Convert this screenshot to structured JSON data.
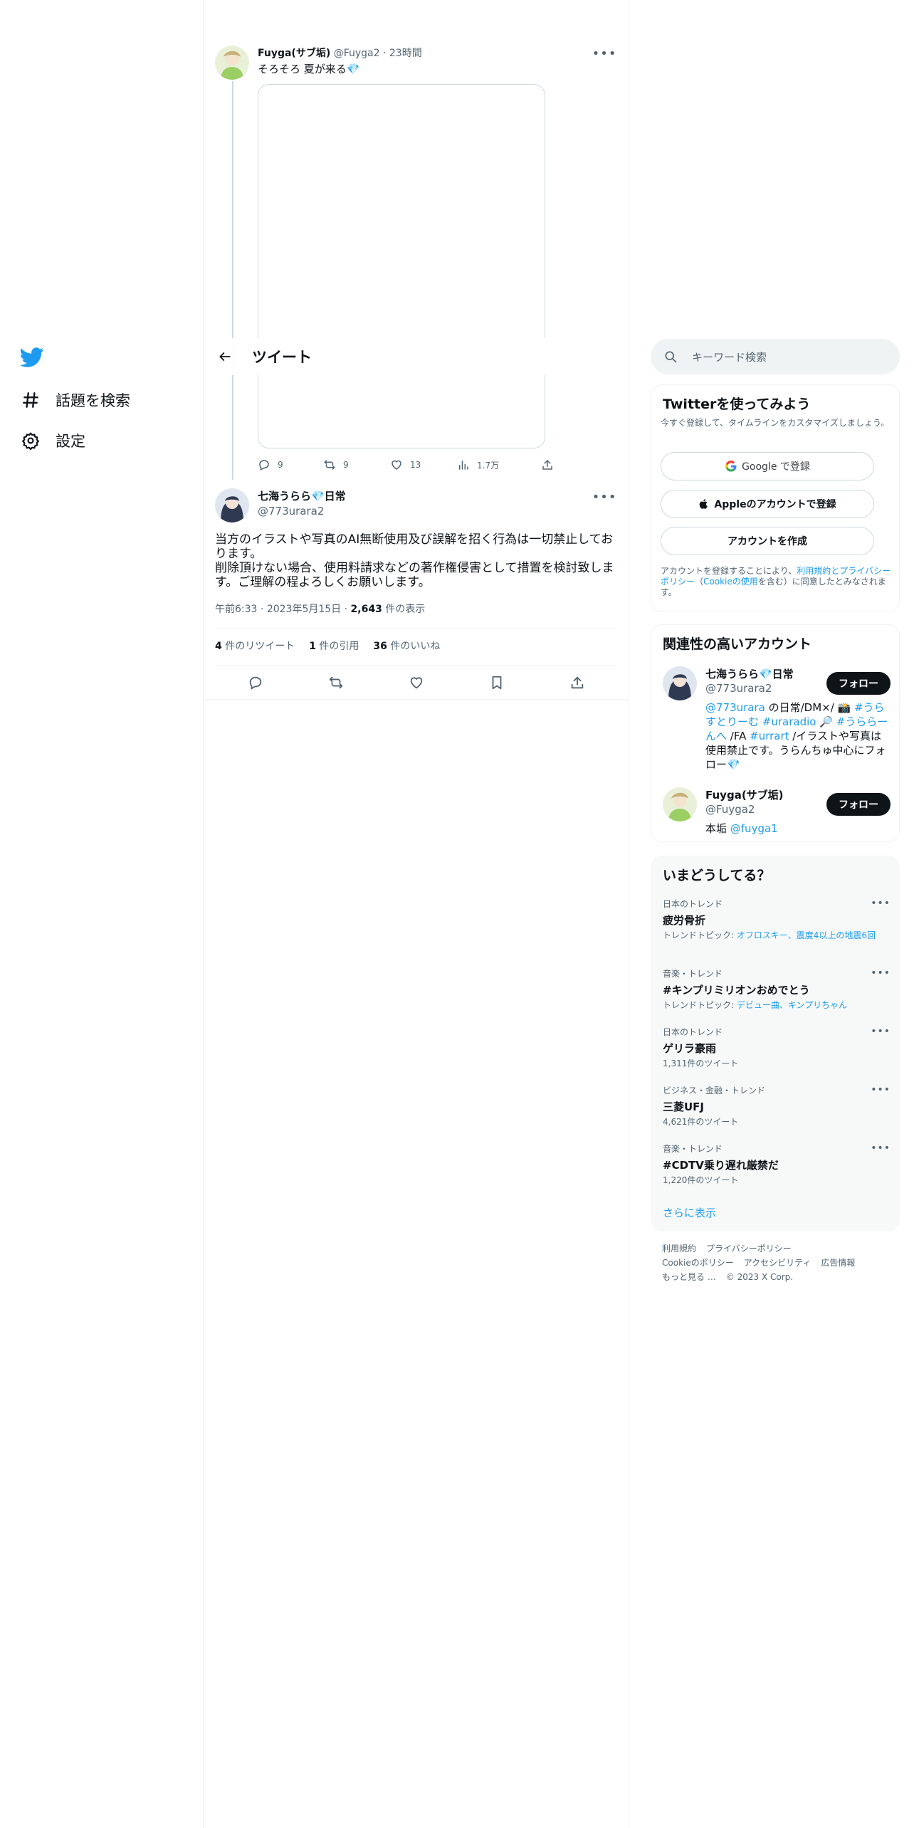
{
  "nav": {
    "explore_label": "話題を検索",
    "settings_label": "設定"
  },
  "header": {
    "title": "ツイート"
  },
  "quoted_tweet": {
    "name": "Fuyga(サブ垢)",
    "handle": "@Fuyga2",
    "separator": "·",
    "time": "23時間",
    "text": "そろそろ 夏が来る💎",
    "counts": {
      "replies": "9",
      "retweets": "9",
      "likes": "13",
      "views": "1.7万"
    }
  },
  "main_tweet": {
    "name": "七海うらら💎日常",
    "handle": "@773urara2",
    "text_lines": [
      "当方のイラストや写真のAI無断使用及び誤解を招く行為は一切禁止しております。",
      "削除頂けない場合、使用料請求などの著作権侵害として措置を検討致します。ご理解の程よろしくお願いします。"
    ],
    "meta": {
      "time": "午前6:33",
      "date": "2023年5月15日",
      "views_count": "2,643",
      "views_label": "件の表示"
    },
    "stats": {
      "retweets_count": "4",
      "retweets_label": "件のリツイート",
      "quotes_count": "1",
      "quotes_label": "件の引用",
      "likes_count": "36",
      "likes_label": "件のいいね"
    }
  },
  "search": {
    "placeholder": "キーワード検索"
  },
  "signup": {
    "title": "Twitterを使ってみよう",
    "subtitle": "今すぐ登録して、タイムラインをカスタマイズしましょう。",
    "google_label": "Google で登録",
    "apple_label": "Appleのアカウントで登録",
    "create_label": "アカウントを作成",
    "terms_prefix": "アカウントを登録することにより、",
    "terms_link": "利用規約とプライバシーポリシー",
    "terms_mid": "（",
    "cookie_link": "Cookieの使用",
    "terms_suffix": "を含む）に同意したとみなされます。"
  },
  "related": {
    "title": "関連性の高いアカウント",
    "follow_label": "フォロー",
    "accounts": [
      {
        "name": "七海うらら💎日常",
        "handle": "@773urara2",
        "bio_parts": [
          "@773urara",
          " の日常/DM×/ 📸 ",
          "#うらすとりーむ",
          " ",
          "#uraradio",
          " 🔎 ",
          "#うららーんへ",
          " /FA ",
          "#urrart",
          " /イラストや写真は使用禁止です。うらんちゅ中心にフォロー💎"
        ]
      },
      {
        "name": "Fuyga(サブ垢)",
        "handle": "@Fuyga2",
        "bio_prefix": "本垢 ",
        "bio_link": "@fuyga1"
      }
    ]
  },
  "trends": {
    "title": "いまどうしてる？",
    "topic_label": "トレンドトピック: ",
    "items": [
      {
        "category": "日本のトレンド",
        "name": "疲労骨折",
        "topics": "オフロスキー、震度4以上の地震6回"
      },
      {
        "category": "音楽・トレンド",
        "name": "#キンプリミリオンおめでとう",
        "topics": "デビュー曲、キンプリちゃん"
      },
      {
        "category": "日本のトレンド",
        "name": "ゲリラ豪雨",
        "tweets": "1,311件のツイート"
      },
      {
        "category": "ビジネス・金融・トレンド",
        "name": "三菱UFJ",
        "tweets": "4,621件のツイート"
      },
      {
        "category": "音楽・トレンド",
        "name": "#CDTV乗り遅れ厳禁だ",
        "tweets": "1,220件のツイート"
      }
    ],
    "show_more": "さらに表示"
  },
  "footer": {
    "links": [
      "利用規約",
      "プライバシーポリシー",
      "Cookieのポリシー",
      "アクセシビリティ",
      "広告情報",
      "もっと見る …"
    ],
    "copyright": "© 2023 X Corp."
  },
  "colors": {
    "accent": "#1d9bf0",
    "text": "#0f1419",
    "secondary": "#536471",
    "border": "#eff3f4"
  }
}
